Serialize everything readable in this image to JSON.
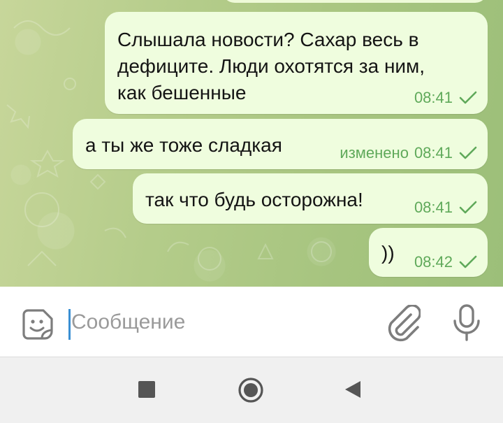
{
  "messages": [
    {
      "lines": [
        "Слышала новости? Сахар весь в",
        "дефиците. Люди охотятся за ним,",
        "как бешенные"
      ],
      "edited": "",
      "time": "08:41",
      "status_icon": "single-check-icon"
    },
    {
      "lines": [
        "а ты же тоже сладкая"
      ],
      "edited": "изменено",
      "time": "08:41",
      "status_icon": "single-check-icon"
    },
    {
      "lines": [
        "так что будь осторожна!"
      ],
      "edited": "",
      "time": "08:41",
      "status_icon": "single-check-icon"
    },
    {
      "lines": [
        "))"
      ],
      "edited": "",
      "time": "08:42",
      "status_icon": "single-check-icon"
    }
  ],
  "input": {
    "placeholder": "Сообщение",
    "left_icon": "sticker-icon",
    "right_icons": [
      "paperclip-icon",
      "microphone-icon"
    ]
  },
  "nav": {
    "icons": [
      "recents-square-icon",
      "home-circle-icon",
      "back-triangle-icon"
    ]
  },
  "colors": {
    "bubble_out": "#effdde",
    "meta_green": "#5fa95a",
    "cursor": "#3a8fd3"
  }
}
